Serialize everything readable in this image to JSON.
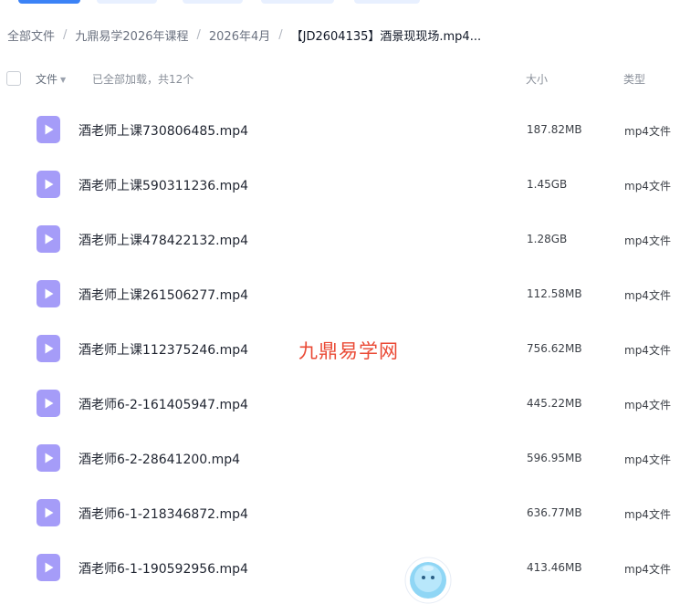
{
  "breadcrumb": {
    "items": [
      "全部文件",
      "九鼎易学2026年课程",
      "2026年4月",
      "【JD2604135】酒景现现场.mp4..."
    ]
  },
  "header": {
    "file_label": "文件",
    "status": "已全部加载，共12个",
    "size_label": "大小",
    "type_label": "类型"
  },
  "files": [
    {
      "name": "酒老师上课730806485.mp4",
      "size": "187.82MB",
      "type": "mp4文件"
    },
    {
      "name": "酒老师上课590311236.mp4",
      "size": "1.45GB",
      "type": "mp4文件"
    },
    {
      "name": "酒老师上课478422132.mp4",
      "size": "1.28GB",
      "type": "mp4文件"
    },
    {
      "name": "酒老师上课261506277.mp4",
      "size": "112.58MB",
      "type": "mp4文件"
    },
    {
      "name": "酒老师上课112375246.mp4",
      "size": "756.62MB",
      "type": "mp4文件"
    },
    {
      "name": "酒老师6-2-161405947.mp4",
      "size": "445.22MB",
      "type": "mp4文件"
    },
    {
      "name": "酒老师6-2-28641200.mp4",
      "size": "596.95MB",
      "type": "mp4文件"
    },
    {
      "name": "酒老师6-1-218346872.mp4",
      "size": "636.77MB",
      "type": "mp4文件"
    },
    {
      "name": "酒老师6-1-190592956.mp4",
      "size": "413.46MB",
      "type": "mp4文件"
    }
  ],
  "watermark": "九鼎易学网",
  "icons": {
    "file": "video-file-icon",
    "sort": "sort-down-icon",
    "assistant": "assistant-mascot-icon"
  },
  "colors": {
    "file_icon": "#a59cf8",
    "watermark": "#ea4a35",
    "accent": "#3b82f6"
  }
}
